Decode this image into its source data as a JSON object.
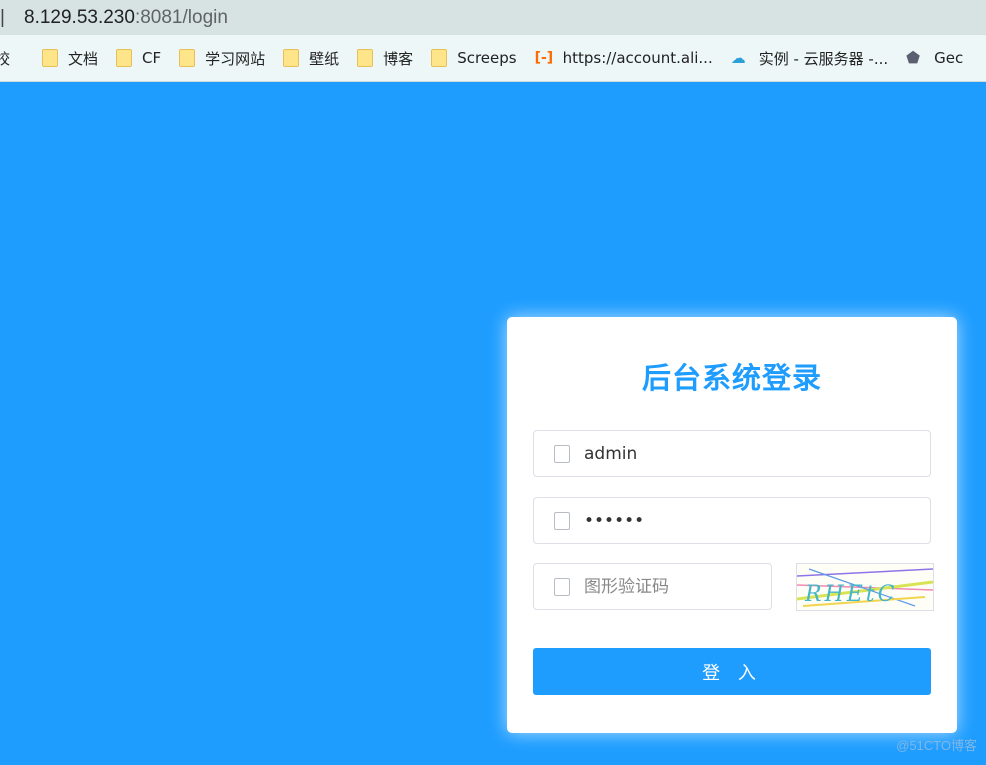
{
  "browser": {
    "address_prefix": "  |",
    "url_host": "8.129.53.230",
    "url_path": ":8081/login",
    "bookmarks": [
      {
        "label": "校",
        "icon": "folder-icon"
      },
      {
        "label": "文档",
        "icon": "folder-icon"
      },
      {
        "label": "CF",
        "icon": "folder-icon"
      },
      {
        "label": "学习网站",
        "icon": "folder-icon"
      },
      {
        "label": "壁纸",
        "icon": "folder-icon"
      },
      {
        "label": "博客",
        "icon": "folder-icon"
      },
      {
        "label": "Screeps",
        "icon": "folder-icon"
      },
      {
        "label": "https://account.ali...",
        "icon": "aliyun-icon"
      },
      {
        "label": "实例 - 云服务器 -...",
        "icon": "cloud-icon"
      },
      {
        "label": "Gec",
        "icon": "gec-icon"
      }
    ]
  },
  "login": {
    "title": "后台系统登录",
    "username_value": "admin",
    "password_value": "••••••",
    "captcha_placeholder": "图形验证码",
    "captcha_text": "RHEtC",
    "submit_label": "登 入"
  },
  "watermark": "@51CTO博客",
  "colors": {
    "accent": "#1e9dff",
    "card": "#ffffff"
  }
}
